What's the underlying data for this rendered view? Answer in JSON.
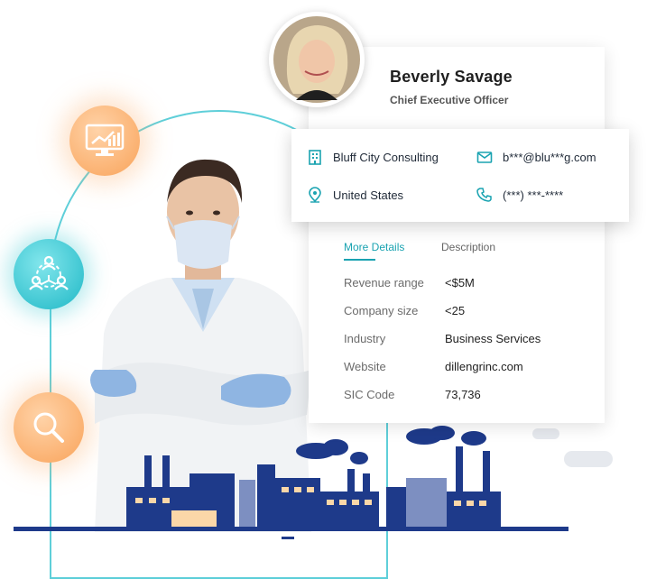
{
  "profile": {
    "name": "Beverly Savage",
    "title": "Chief Executive Officer"
  },
  "contact": {
    "company": "Bluff City Consulting",
    "email": "b***@blu***g.com",
    "location": "United States",
    "phone": "(***) ***-****"
  },
  "tabs": [
    {
      "label": "More Details",
      "active": true
    },
    {
      "label": "Description",
      "active": false
    }
  ],
  "details": [
    {
      "label": "Revenue range",
      "value": "<$5M"
    },
    {
      "label": "Company size",
      "value": "<25"
    },
    {
      "label": "Industry",
      "value": "Business Services"
    },
    {
      "label": "Website",
      "value": "dillengrinc.com"
    },
    {
      "label": "SIC Code",
      "value": "73,736"
    }
  ],
  "colors": {
    "accent": "#1aa3b1",
    "arch": "#5fcfd9",
    "orange": "#f9a35a",
    "factory": "#1e3a8a"
  },
  "icons": [
    "monitor-chart-icon",
    "network-users-icon",
    "search-icon",
    "building-icon",
    "mail-icon",
    "location-pin-icon",
    "phone-icon"
  ]
}
